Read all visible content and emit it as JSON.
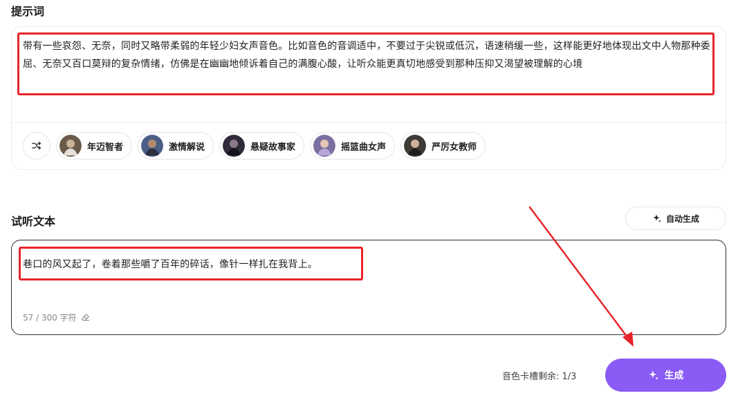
{
  "prompt_section": {
    "title": "提示词",
    "text": "带有一些哀怨、无奈，同时又略带柔弱的年轻少妇女声音色。比如音色的音调适中，不要过于尖锐或低沉，语速稍缓一些，这样能更好地体现出文中人物那种委屈、无奈又百口莫辩的复杂情绪，仿佛是在幽幽地倾诉着自己的满腹心酸，让听众能更真切地感受到那种压抑又渴望被理解的心境",
    "shuffle_icon": "shuffle-icon",
    "presets": [
      {
        "label": "年迈智者",
        "avatar_color": "#6b5a48"
      },
      {
        "label": "激情解说",
        "avatar_color": "#4a5f86"
      },
      {
        "label": "悬疑故事家",
        "avatar_color": "#2f2b3a"
      },
      {
        "label": "摇篮曲女声",
        "avatar_color": "#7a6fa0"
      },
      {
        "label": "严厉女教师",
        "avatar_color": "#3e3a36"
      }
    ]
  },
  "preview_section": {
    "title": "试听文本",
    "auto_generate_label": "自动生成",
    "text": "巷口的风又起了，卷着那些嚼了百年的碎话，像针一样扎在我背上。",
    "char_count": "57 / 300 字符",
    "clear_icon": "eraser-icon"
  },
  "footer": {
    "slot_info": "音色卡槽剩余:  1/3",
    "generate_label": "生成",
    "sparkle_icon": "sparkle-icon"
  },
  "colors": {
    "accent": "#8a5cf5",
    "annotation_red": "#e8242a"
  }
}
